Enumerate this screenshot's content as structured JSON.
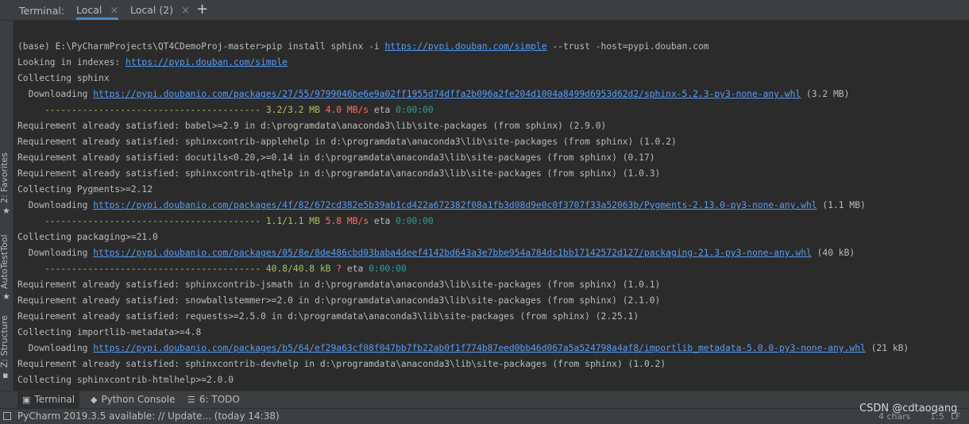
{
  "tabbar": {
    "title": "Terminal:",
    "tabs": [
      {
        "label": "Local",
        "active": true
      },
      {
        "label": "Local (2)",
        "active": false
      }
    ],
    "close_glyph": "×",
    "add_glyph": "+"
  },
  "left_strip": {
    "items": [
      {
        "label": "2: Favorites",
        "icon": "star-icon"
      },
      {
        "label": "AutoTestTool",
        "icon": "star-icon"
      },
      {
        "label": "Z: Structure",
        "icon": "structure-icon"
      }
    ]
  },
  "terminal": {
    "lines": [
      {
        "segments": [
          {
            "t": "(base) E:\\PyCharmProjects\\QT4CDemoProj-master>pip install sphinx -i "
          },
          {
            "t": "https://pypi.douban.com/simple",
            "c": "link"
          },
          {
            "t": " --trust -host=pypi.douban.com"
          }
        ]
      },
      {
        "segments": [
          {
            "t": "Looking in indexes: "
          },
          {
            "t": "https://pypi.douban.com/simple",
            "c": "link"
          }
        ]
      },
      {
        "segments": [
          {
            "t": "Collecting sphinx"
          }
        ]
      },
      {
        "segments": [
          {
            "t": "  Downloading "
          },
          {
            "t": "https://pypi.doubanio.com/packages/27/55/9799046be6e9a02ff1955d74dffa2b096a2fe204d1004a8499d6953d62d2/sphinx-5.2.3-py3-none-any.whl",
            "c": "link"
          },
          {
            "t": " (3.2 MB)"
          }
        ]
      },
      {
        "segments": [
          {
            "t": "     ---------------------------------------- 3.2/3.2 MB",
            "c": "green"
          },
          {
            "t": " "
          },
          {
            "t": "4.0 MB/s",
            "c": "red"
          },
          {
            "t": " eta "
          },
          {
            "t": "0:00:00",
            "c": "cyan"
          }
        ]
      },
      {
        "segments": [
          {
            "t": "Requirement already satisfied: babel>=2.9 in d:\\programdata\\anaconda3\\lib\\site-packages (from sphinx) (2.9.0)"
          }
        ]
      },
      {
        "segments": [
          {
            "t": "Requirement already satisfied: sphinxcontrib-applehelp in d:\\programdata\\anaconda3\\lib\\site-packages (from sphinx) (1.0.2)"
          }
        ]
      },
      {
        "segments": [
          {
            "t": "Requirement already satisfied: docutils<0.20,>=0.14 in d:\\programdata\\anaconda3\\lib\\site-packages (from sphinx) (0.17)"
          }
        ]
      },
      {
        "segments": [
          {
            "t": "Requirement already satisfied: sphinxcontrib-qthelp in d:\\programdata\\anaconda3\\lib\\site-packages (from sphinx) (1.0.3)"
          }
        ]
      },
      {
        "segments": [
          {
            "t": "Collecting Pygments>=2.12"
          }
        ]
      },
      {
        "segments": [
          {
            "t": "  Downloading "
          },
          {
            "t": "https://pypi.doubanio.com/packages/4f/82/672cd382e5b39ab1cd422a672382f08a1fb3d08d9e0c0f3707f33a52063b/Pygments-2.13.0-py3-none-any.whl",
            "c": "link"
          },
          {
            "t": " (1.1 MB)"
          }
        ]
      },
      {
        "segments": [
          {
            "t": "     ---------------------------------------- 1.1/1.1 MB",
            "c": "green"
          },
          {
            "t": " "
          },
          {
            "t": "5.8 MB/s",
            "c": "red"
          },
          {
            "t": " eta "
          },
          {
            "t": "0:00:00",
            "c": "cyan"
          }
        ]
      },
      {
        "segments": [
          {
            "t": "Collecting packaging>=21.0"
          }
        ]
      },
      {
        "segments": [
          {
            "t": "  Downloading "
          },
          {
            "t": "https://pypi.doubanio.com/packages/05/8e/8de486cbd03baba4deef4142bd643a3e7bbe954a784dc1bb17142572d127/packaging-21.3-py3-none-any.whl",
            "c": "link"
          },
          {
            "t": " (40 kB)"
          }
        ]
      },
      {
        "segments": [
          {
            "t": "     ---------------------------------------- 40.8/40.8 kB",
            "c": "green"
          },
          {
            "t": " "
          },
          {
            "t": "?",
            "c": "red"
          },
          {
            "t": " eta "
          },
          {
            "t": "0:00:00",
            "c": "cyan"
          }
        ]
      },
      {
        "segments": [
          {
            "t": "Requirement already satisfied: sphinxcontrib-jsmath in d:\\programdata\\anaconda3\\lib\\site-packages (from sphinx) (1.0.1)"
          }
        ]
      },
      {
        "segments": [
          {
            "t": "Requirement already satisfied: snowballstemmer>=2.0 in d:\\programdata\\anaconda3\\lib\\site-packages (from sphinx) (2.1.0)"
          }
        ]
      },
      {
        "segments": [
          {
            "t": "Requirement already satisfied: requests>=2.5.0 in d:\\programdata\\anaconda3\\lib\\site-packages (from sphinx) (2.25.1)"
          }
        ]
      },
      {
        "segments": [
          {
            "t": "Collecting importlib-metadata>=4.8"
          }
        ]
      },
      {
        "segments": [
          {
            "t": "  Downloading "
          },
          {
            "t": "https://pypi.doubanio.com/packages/b5/64/ef29a63cf08f047bb7fb22ab0f1f774b87eed0bb46d067a5a524798a4af8/importlib_metadata-5.0.0-py3-none-any.whl",
            "c": "link"
          },
          {
            "t": " (21 kB)"
          }
        ]
      },
      {
        "segments": [
          {
            "t": "Requirement already satisfied: sphinxcontrib-devhelp in d:\\programdata\\anaconda3\\lib\\site-packages (from sphinx) (1.0.2)"
          }
        ]
      },
      {
        "segments": [
          {
            "t": "Collecting sphinxcontrib-htmlhelp>=2.0.0"
          }
        ]
      }
    ]
  },
  "bottom_tabs": [
    {
      "label": "Terminal",
      "icon": "terminal-icon",
      "active": true
    },
    {
      "label": "Python Console",
      "icon": "python-icon",
      "active": false
    },
    {
      "label": "6: TODO",
      "icon": "todo-icon",
      "active": false
    }
  ],
  "status": {
    "message": "PyCharm 2019.3.5 available: // Update... (today 14:38)",
    "chars": "4 chars",
    "position": "1:5",
    "line_sep": "LF"
  },
  "watermark": "CSDN @cdtaogang",
  "colors": {
    "background": "#2b2b2b",
    "link": "#589df6",
    "progress": "#a5c261",
    "speed": "#ff6b68",
    "eta": "#2aa198"
  }
}
